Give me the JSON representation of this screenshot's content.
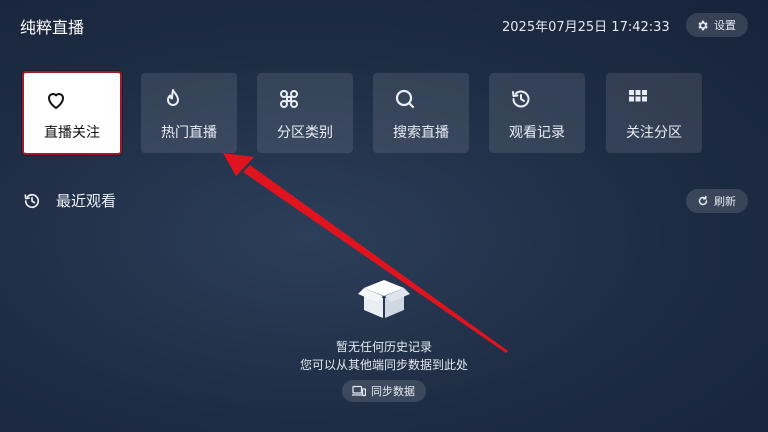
{
  "header": {
    "app_title": "纯粹直播",
    "datetime": "2025年07月25日 17:42:33",
    "settings_label": "设置"
  },
  "tiles": [
    {
      "label": "直播关注",
      "icon": "heart-icon",
      "active": true
    },
    {
      "label": "热门直播",
      "icon": "flame-icon",
      "active": false
    },
    {
      "label": "分区类别",
      "icon": "command-icon",
      "active": false
    },
    {
      "label": "搜索直播",
      "icon": "search-icon",
      "active": false
    },
    {
      "label": "观看记录",
      "icon": "history-icon",
      "active": false
    },
    {
      "label": "关注分区",
      "icon": "grid-icon",
      "active": false
    }
  ],
  "recent": {
    "title": "最近观看",
    "refresh_label": "刷新",
    "empty_title": "暂无任何历史记录",
    "empty_subtitle": "您可以从其他端同步数据到此处",
    "sync_label": "同步数据"
  },
  "colors": {
    "active_border": "#a11a2a",
    "annotation_arrow": "#e0141e"
  }
}
